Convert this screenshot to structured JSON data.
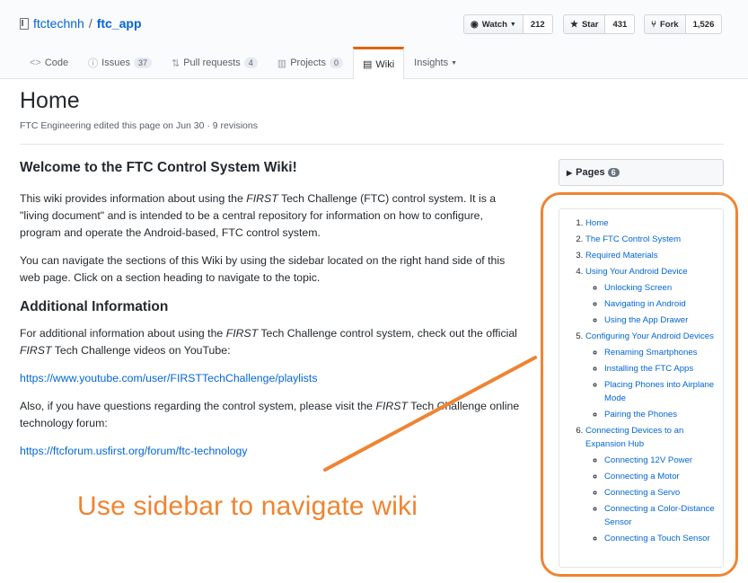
{
  "repo": {
    "owner": "ftctechnh",
    "separator": "/",
    "name": "ftc_app"
  },
  "actions": [
    {
      "label": "Watch",
      "count": "212"
    },
    {
      "label": "Star",
      "count": "431"
    },
    {
      "label": "Fork",
      "count": "1,526"
    }
  ],
  "tabs": [
    {
      "label": "Code"
    },
    {
      "label": "Issues",
      "count": "37"
    },
    {
      "label": "Pull requests",
      "count": "4"
    },
    {
      "label": "Projects",
      "count": "0"
    },
    {
      "label": "Wiki"
    },
    {
      "label": "Insights"
    }
  ],
  "page": {
    "title": "Home",
    "meta": "FTC Engineering edited this page on Jun 30 · 9 revisions"
  },
  "content": {
    "heading": "Welcome to the FTC Control System Wiki!",
    "p1_a": "This wiki provides information about using the ",
    "p1_em": "FIRST",
    "p1_b": " Tech Challenge (FTC) control system. It is a \"living document\" and is intended to be a central repository for information on how to configure, program and operate the Android-based, FTC control system.",
    "p2": "You can navigate the sections of this Wiki by using the sidebar located on the right hand side of this web page. Click on a section heading to navigate to the topic.",
    "heading2": "Additional Information",
    "p3_a": "For additional information about using the ",
    "p3_em1": "FIRST",
    "p3_b": " Tech Challenge control system, check out the official ",
    "p3_em2": "FIRST",
    "p3_c": " Tech Challenge videos on YouTube:",
    "link1": "https://www.youtube.com/user/FIRSTTechChallenge/playlists",
    "p4_a": "Also, if you have questions regarding the control system, please visit the ",
    "p4_em": "FIRST",
    "p4_b": " Tech Challenge online technology forum:",
    "link2": "https://ftcforum.usfirst.org/forum/ftc-technology"
  },
  "sidebar": {
    "pages_label": "Pages",
    "pages_count": "6",
    "toc": [
      {
        "label": "Home"
      },
      {
        "label": "The FTC Control System"
      },
      {
        "label": "Required Materials"
      },
      {
        "label": "Using Your Android Device",
        "children": [
          "Unlocking Screen",
          "Navigating in Android",
          "Using the App Drawer"
        ]
      },
      {
        "label": "Configuring Your Android Devices",
        "children": [
          "Renaming Smartphones",
          "Installing the FTC Apps",
          "Placing Phones into Airplane Mode",
          "Pairing the Phones"
        ]
      },
      {
        "label": "Connecting Devices to an Expansion Hub",
        "children": [
          "Connecting 12V Power",
          "Connecting a Motor",
          "Connecting a Servo",
          "Connecting a Color-Distance Sensor",
          "Connecting a Touch Sensor"
        ]
      }
    ]
  },
  "annotation": {
    "text": "Use sidebar to navigate wiki",
    "color": "#ef8432"
  }
}
